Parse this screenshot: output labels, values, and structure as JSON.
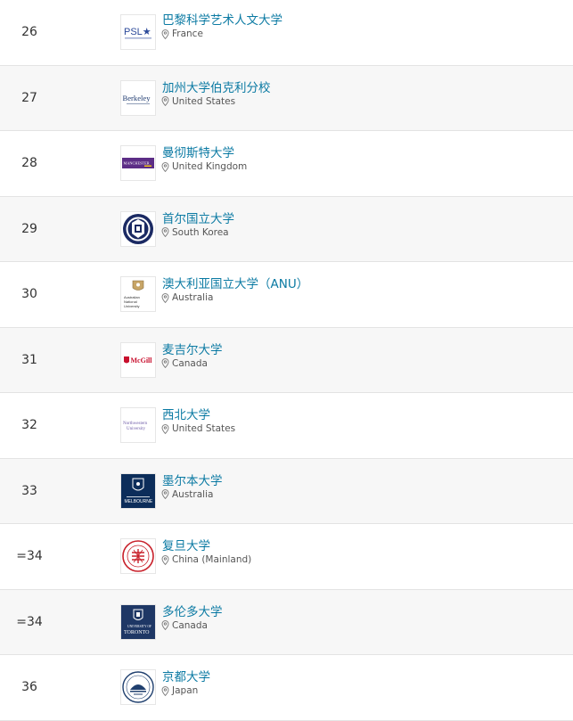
{
  "rows": [
    {
      "rank": "26",
      "name": "巴黎科学艺术人文大学",
      "country": "France",
      "logo_text": "PSL★",
      "logo_icon": "psl-logo-icon"
    },
    {
      "rank": "27",
      "name": "加州大学伯克利分校",
      "country": "United States",
      "logo_text": "Berkeley",
      "logo_icon": "berkeley-logo-icon"
    },
    {
      "rank": "28",
      "name": "曼彻斯特大学",
      "country": "United Kingdom",
      "logo_text": "MANCHESTER",
      "logo_icon": "manchester-logo-icon"
    },
    {
      "rank": "29",
      "name": "首尔国立大学",
      "country": "South Korea",
      "logo_text": "",
      "logo_icon": "snu-seal-icon"
    },
    {
      "rank": "30",
      "name": "澳大利亚国立大学（ANU）",
      "country": "Australia",
      "logo_text": "Australian National University",
      "logo_icon": "anu-crest-icon"
    },
    {
      "rank": "31",
      "name": "麦吉尔大学",
      "country": "Canada",
      "logo_text": "McGill",
      "logo_icon": "mcgill-logo-icon"
    },
    {
      "rank": "32",
      "name": "西北大学",
      "country": "United States",
      "logo_text": "Northwestern University",
      "logo_icon": "northwestern-logo-icon"
    },
    {
      "rank": "33",
      "name": "墨尔本大学",
      "country": "Australia",
      "logo_text": "MELBOURNE",
      "logo_icon": "melbourne-crest-icon"
    },
    {
      "rank": "=34",
      "name": "复旦大学",
      "country": "China (Mainland)",
      "logo_text": "",
      "logo_icon": "fudan-seal-icon"
    },
    {
      "rank": "=34",
      "name": "多伦多大学",
      "country": "Canada",
      "logo_text": "TORONTO",
      "logo_icon": "toronto-crest-icon"
    },
    {
      "rank": "36",
      "name": "京都大学",
      "country": "Japan",
      "logo_text": "",
      "logo_icon": "kyoto-seal-icon"
    }
  ],
  "colors": {
    "link": "#0b7aa3",
    "psl_blue": "#2c4a9a",
    "berkeley_navy": "#1f3b70",
    "manchester_purple": "#5c2d86",
    "snu_navy": "#1b2a63",
    "mcgill_red": "#c8102e",
    "northwestern_purple": "#6f5da8",
    "melbourne_navy": "#0c2d5a",
    "fudan_red": "#c8202a",
    "toronto_navy": "#1e3765",
    "kyoto_navy": "#1f3f6e"
  }
}
